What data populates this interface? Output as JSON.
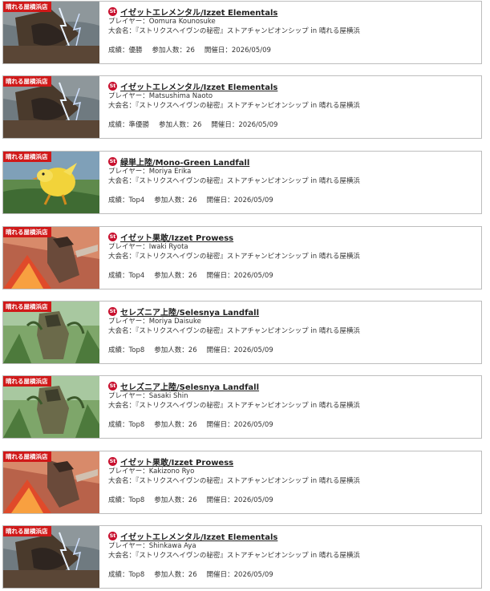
{
  "labels": {
    "player": "プレイヤー：",
    "event": "大会名：",
    "result": "成績：",
    "participants": "参加人数：",
    "date": "開催日："
  },
  "shop_badge": "晴れる屋横浜店",
  "st_icon": "St",
  "entries": [
    {
      "art": "izzet-elementals-art",
      "deck": "イゼットエレメンタル/Izzet Elementals",
      "player": "Oomura Kounosuke",
      "event": "『ストリクスヘイヴンの秘密』ストアチャンピオンシップ in 晴れる屋横浜",
      "result": "優勝",
      "participants": "26",
      "date": "2026/05/09"
    },
    {
      "art": "izzet-elementals-art",
      "deck": "イゼットエレメンタル/Izzet Elementals",
      "player": "Matsushima Naoto",
      "event": "『ストリクスヘイヴンの秘密』ストアチャンピオンシップ in 晴れる屋横浜",
      "result": "準優勝",
      "participants": "26",
      "date": "2026/05/09"
    },
    {
      "art": "mono-green-landfall-art",
      "deck": "緑単上陸/Mono-Green Landfall",
      "player": "Moriya Erika",
      "event": "『ストリクスヘイヴンの秘密』ストアチャンピオンシップ in 晴れる屋横浜",
      "result": "Top4",
      "participants": "26",
      "date": "2026/05/09"
    },
    {
      "art": "izzet-prowess-art",
      "deck": "イゼット果敢/Izzet Prowess",
      "player": "Iwaki Ryota",
      "event": "『ストリクスヘイヴンの秘密』ストアチャンピオンシップ in 晴れる屋横浜",
      "result": "Top4",
      "participants": "26",
      "date": "2026/05/09"
    },
    {
      "art": "selesnya-landfall-art",
      "deck": "セレズニア上陸/Selesnya Landfall",
      "player": "Moriya Daisuke",
      "event": "『ストリクスヘイヴンの秘密』ストアチャンピオンシップ in 晴れる屋横浜",
      "result": "Top8",
      "participants": "26",
      "date": "2026/05/09"
    },
    {
      "art": "selesnya-landfall-art",
      "deck": "セレズニア上陸/Selesnya Landfall",
      "player": "Sasaki Shin",
      "event": "『ストリクスヘイヴンの秘密』ストアチャンピオンシップ in 晴れる屋横浜",
      "result": "Top8",
      "participants": "26",
      "date": "2026/05/09"
    },
    {
      "art": "izzet-prowess-art",
      "deck": "イゼット果敢/Izzet Prowess",
      "player": "Kakizono Ryo",
      "event": "『ストリクスヘイヴンの秘密』ストアチャンピオンシップ in 晴れる屋横浜",
      "result": "Top8",
      "participants": "26",
      "date": "2026/05/09"
    },
    {
      "art": "izzet-elementals-art",
      "deck": "イゼットエレメンタル/Izzet Elementals",
      "player": "Shinkawa Aya",
      "event": "『ストリクスヘイヴンの秘密』ストアチャンピオンシップ in 晴れる屋横浜",
      "result": "Top8",
      "participants": "26",
      "date": "2026/05/09"
    }
  ]
}
